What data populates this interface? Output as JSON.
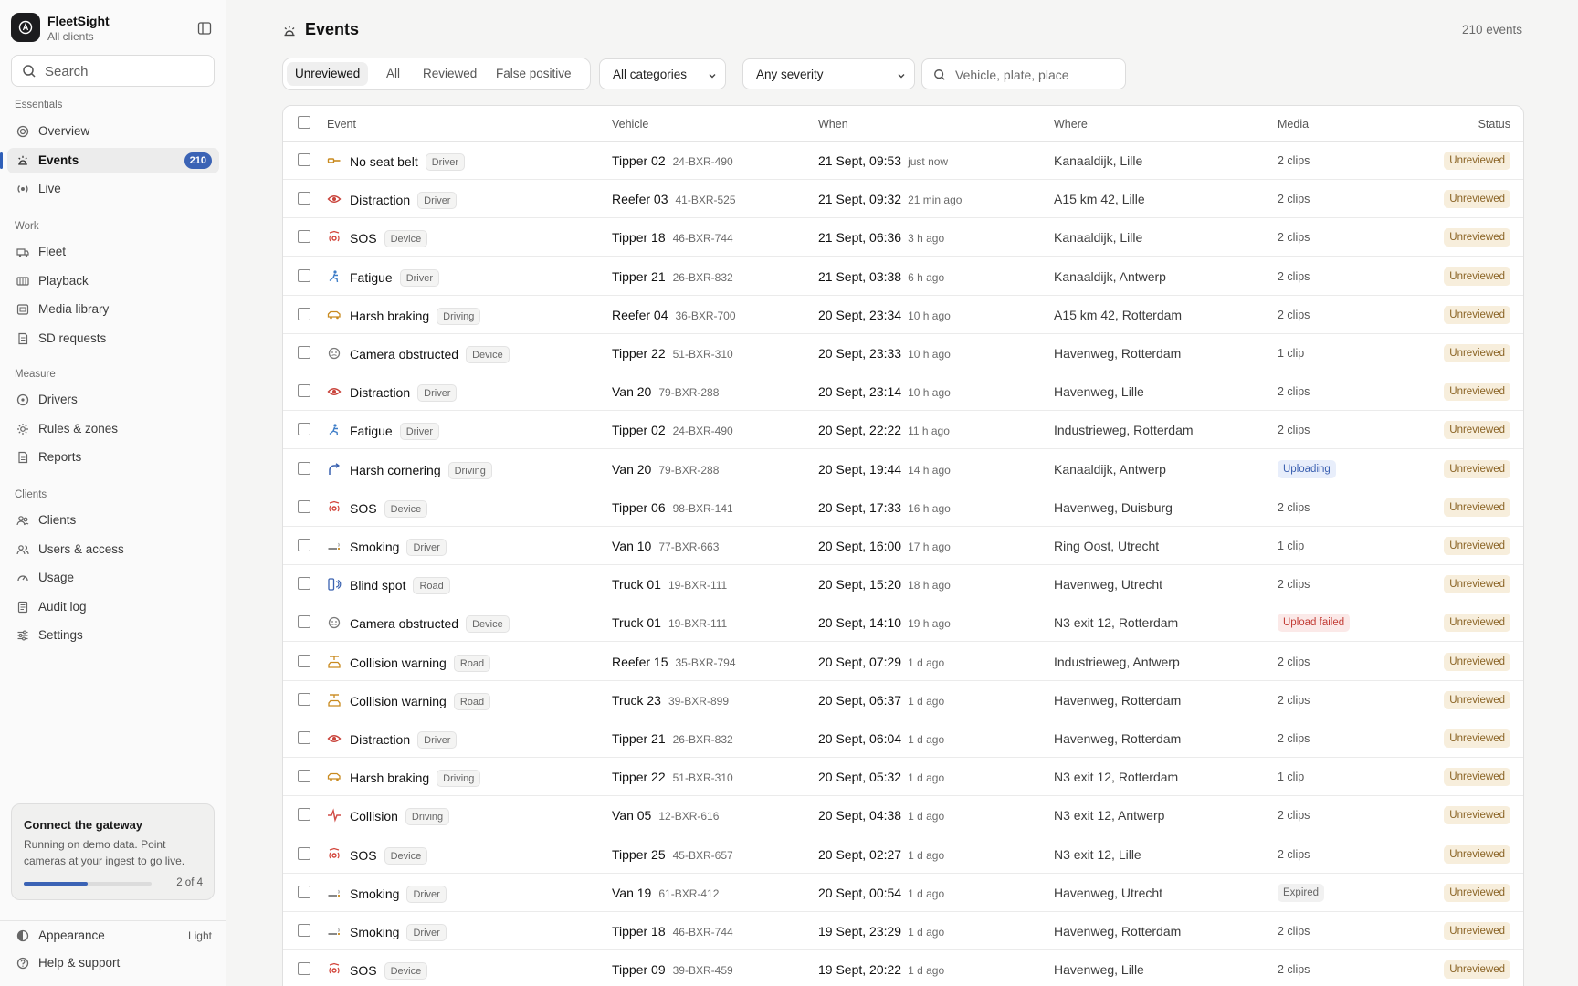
{
  "brand": {
    "name": "FleetSight",
    "sub": "All clients"
  },
  "search": {
    "placeholder": "Search"
  },
  "nav": {
    "essentials_label": "Essentials",
    "essentials": [
      {
        "label": "Overview",
        "icon": "overview-icon"
      },
      {
        "label": "Events",
        "icon": "events-icon",
        "badge": "210",
        "active": true
      },
      {
        "label": "Live",
        "icon": "live-icon"
      }
    ],
    "work_label": "Work",
    "work": [
      {
        "label": "Fleet",
        "icon": "truck-icon"
      },
      {
        "label": "Playback",
        "icon": "playback-icon"
      },
      {
        "label": "Media library",
        "icon": "media-icon"
      },
      {
        "label": "SD requests",
        "icon": "sd-card-icon"
      }
    ],
    "measure_label": "Measure",
    "measure": [
      {
        "label": "Drivers",
        "icon": "drivers-icon"
      },
      {
        "label": "Rules & zones",
        "icon": "rules-icon"
      },
      {
        "label": "Reports",
        "icon": "reports-icon"
      }
    ],
    "clients_label": "Clients",
    "clients": [
      {
        "label": "Clients",
        "icon": "clients-icon"
      },
      {
        "label": "Users & access",
        "icon": "users-icon"
      },
      {
        "label": "Usage",
        "icon": "usage-icon"
      },
      {
        "label": "Audit log",
        "icon": "audit-icon"
      },
      {
        "label": "Settings",
        "icon": "settings-icon"
      }
    ]
  },
  "gateway": {
    "title": "Connect the gateway",
    "desc": "Running on demo data. Point cameras at your ingest to go live.",
    "progress": 0.5,
    "step": "2 of 4"
  },
  "footer": {
    "appearance": "Appearance",
    "appearance_value": "Light",
    "help": "Help & support"
  },
  "page": {
    "title": "Events",
    "count": "210 events"
  },
  "tabs": [
    "Unreviewed",
    "All",
    "Reviewed",
    "False positive"
  ],
  "filters": {
    "category": "All categories",
    "severity": "Any severity",
    "search_placeholder": "Vehicle, plate, place"
  },
  "columns": {
    "event": "Event",
    "vehicle": "Vehicle",
    "when": "When",
    "where": "Where",
    "media": "Media",
    "status": "Status"
  },
  "colors": {
    "accent": "#3b63b5",
    "sos": "#d2453b",
    "distraction": "#c9433b",
    "fatigue": "#3f7ec8",
    "braking": "#c98a1f",
    "cornering": "#3a62b0",
    "collision": "#d14f49",
    "neutral": "#7a7a7a"
  },
  "rows": [
    {
      "event": "No seat belt",
      "tag": "Driver",
      "icon": "seatbelt-icon",
      "vehicle": "Tipper 02",
      "plate": "24-BXR-490",
      "when": "21 Sept, 09:53",
      "ago": "just now",
      "where": "Kanaaldijk, Lille",
      "media": "2 clips",
      "status": "Unreviewed"
    },
    {
      "event": "Distraction",
      "tag": "Driver",
      "icon": "eye-icon",
      "vehicle": "Reefer 03",
      "plate": "41-BXR-525",
      "when": "21 Sept, 09:32",
      "ago": "21 min ago",
      "where": "A15 km 42, Lille",
      "media": "2 clips",
      "status": "Unreviewed"
    },
    {
      "event": "SOS",
      "tag": "Device",
      "icon": "sos-icon",
      "vehicle": "Tipper 18",
      "plate": "46-BXR-744",
      "when": "21 Sept, 06:36",
      "ago": "3 h ago",
      "where": "Kanaaldijk, Lille",
      "media": "2 clips",
      "status": "Unreviewed"
    },
    {
      "event": "Fatigue",
      "tag": "Driver",
      "icon": "fatigue-icon",
      "vehicle": "Tipper 21",
      "plate": "26-BXR-832",
      "when": "21 Sept, 03:38",
      "ago": "6 h ago",
      "where": "Kanaaldijk, Antwerp",
      "media": "2 clips",
      "status": "Unreviewed"
    },
    {
      "event": "Harsh braking",
      "tag": "Driving",
      "icon": "braking-icon",
      "vehicle": "Reefer 04",
      "plate": "36-BXR-700",
      "when": "20 Sept, 23:34",
      "ago": "10 h ago",
      "where": "A15 km 42, Rotterdam",
      "media": "2 clips",
      "status": "Unreviewed"
    },
    {
      "event": "Camera obstructed",
      "tag": "Device",
      "icon": "camera-obstructed-icon",
      "vehicle": "Tipper 22",
      "plate": "51-BXR-310",
      "when": "20 Sept, 23:33",
      "ago": "10 h ago",
      "where": "Havenweg, Rotterdam",
      "media": "1 clip",
      "status": "Unreviewed"
    },
    {
      "event": "Distraction",
      "tag": "Driver",
      "icon": "eye-icon",
      "vehicle": "Van 20",
      "plate": "79-BXR-288",
      "when": "20 Sept, 23:14",
      "ago": "10 h ago",
      "where": "Havenweg, Lille",
      "media": "2 clips",
      "status": "Unreviewed"
    },
    {
      "event": "Fatigue",
      "tag": "Driver",
      "icon": "fatigue-icon",
      "vehicle": "Tipper 02",
      "plate": "24-BXR-490",
      "when": "20 Sept, 22:22",
      "ago": "11 h ago",
      "where": "Industrieweg, Rotterdam",
      "media": "2 clips",
      "status": "Unreviewed"
    },
    {
      "event": "Harsh cornering",
      "tag": "Driving",
      "icon": "cornering-icon",
      "vehicle": "Van 20",
      "plate": "79-BXR-288",
      "when": "20 Sept, 19:44",
      "ago": "14 h ago",
      "where": "Kanaaldijk, Antwerp",
      "media": "Uploading",
      "media_kind": "uploading",
      "status": "Unreviewed"
    },
    {
      "event": "SOS",
      "tag": "Device",
      "icon": "sos-icon",
      "vehicle": "Tipper 06",
      "plate": "98-BXR-141",
      "when": "20 Sept, 17:33",
      "ago": "16 h ago",
      "where": "Havenweg, Duisburg",
      "media": "2 clips",
      "status": "Unreviewed"
    },
    {
      "event": "Smoking",
      "tag": "Driver",
      "icon": "smoking-icon",
      "vehicle": "Van 10",
      "plate": "77-BXR-663",
      "when": "20 Sept, 16:00",
      "ago": "17 h ago",
      "where": "Ring Oost, Utrecht",
      "media": "1 clip",
      "status": "Unreviewed"
    },
    {
      "event": "Blind spot",
      "tag": "Road",
      "icon": "blind-spot-icon",
      "vehicle": "Truck 01",
      "plate": "19-BXR-111",
      "when": "20 Sept, 15:20",
      "ago": "18 h ago",
      "where": "Havenweg, Utrecht",
      "media": "2 clips",
      "status": "Unreviewed"
    },
    {
      "event": "Camera obstructed",
      "tag": "Device",
      "icon": "camera-obstructed-icon",
      "vehicle": "Truck 01",
      "plate": "19-BXR-111",
      "when": "20 Sept, 14:10",
      "ago": "19 h ago",
      "where": "N3 exit 12, Rotterdam",
      "media": "Upload failed",
      "media_kind": "failed",
      "status": "Unreviewed"
    },
    {
      "event": "Collision warning",
      "tag": "Road",
      "icon": "collision-warning-icon",
      "vehicle": "Reefer 15",
      "plate": "35-BXR-794",
      "when": "20 Sept, 07:29",
      "ago": "1 d ago",
      "where": "Industrieweg, Antwerp",
      "media": "2 clips",
      "status": "Unreviewed"
    },
    {
      "event": "Collision warning",
      "tag": "Road",
      "icon": "collision-warning-icon",
      "vehicle": "Truck 23",
      "plate": "39-BXR-899",
      "when": "20 Sept, 06:37",
      "ago": "1 d ago",
      "where": "Havenweg, Rotterdam",
      "media": "2 clips",
      "status": "Unreviewed"
    },
    {
      "event": "Distraction",
      "tag": "Driver",
      "icon": "eye-icon",
      "vehicle": "Tipper 21",
      "plate": "26-BXR-832",
      "when": "20 Sept, 06:04",
      "ago": "1 d ago",
      "where": "Havenweg, Rotterdam",
      "media": "2 clips",
      "status": "Unreviewed"
    },
    {
      "event": "Harsh braking",
      "tag": "Driving",
      "icon": "braking-icon",
      "vehicle": "Tipper 22",
      "plate": "51-BXR-310",
      "when": "20 Sept, 05:32",
      "ago": "1 d ago",
      "where": "N3 exit 12, Rotterdam",
      "media": "1 clip",
      "status": "Unreviewed"
    },
    {
      "event": "Collision",
      "tag": "Driving",
      "icon": "collision-icon",
      "vehicle": "Van 05",
      "plate": "12-BXR-616",
      "when": "20 Sept, 04:38",
      "ago": "1 d ago",
      "where": "N3 exit 12, Antwerp",
      "media": "2 clips",
      "status": "Unreviewed"
    },
    {
      "event": "SOS",
      "tag": "Device",
      "icon": "sos-icon",
      "vehicle": "Tipper 25",
      "plate": "45-BXR-657",
      "when": "20 Sept, 02:27",
      "ago": "1 d ago",
      "where": "N3 exit 12, Lille",
      "media": "2 clips",
      "status": "Unreviewed"
    },
    {
      "event": "Smoking",
      "tag": "Driver",
      "icon": "smoking-icon",
      "vehicle": "Van 19",
      "plate": "61-BXR-412",
      "when": "20 Sept, 00:54",
      "ago": "1 d ago",
      "where": "Havenweg, Utrecht",
      "media": "Expired",
      "media_kind": "expired",
      "status": "Unreviewed"
    },
    {
      "event": "Smoking",
      "tag": "Driver",
      "icon": "smoking-icon",
      "vehicle": "Tipper 18",
      "plate": "46-BXR-744",
      "when": "19 Sept, 23:29",
      "ago": "1 d ago",
      "where": "Havenweg, Rotterdam",
      "media": "2 clips",
      "status": "Unreviewed"
    },
    {
      "event": "SOS",
      "tag": "Device",
      "icon": "sos-icon",
      "vehicle": "Tipper 09",
      "plate": "39-BXR-459",
      "when": "19 Sept, 20:22",
      "ago": "1 d ago",
      "where": "Havenweg, Lille",
      "media": "2 clips",
      "status": "Unreviewed"
    }
  ]
}
